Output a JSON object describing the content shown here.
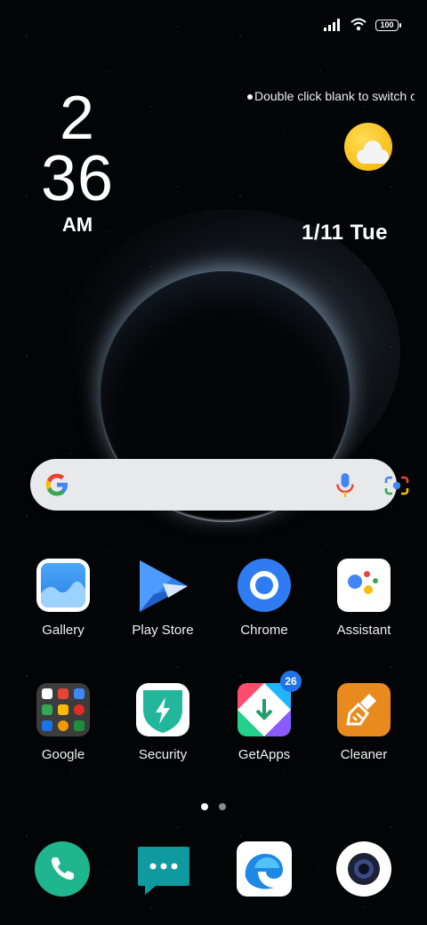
{
  "status_bar": {
    "battery": "100",
    "icons": [
      "signal-icon",
      "wifi-icon",
      "battery-icon"
    ]
  },
  "clock": {
    "hour": "2",
    "minute": "36",
    "ampm": "AM"
  },
  "hint": "Double click blank to switch cl",
  "date": "1/11  Tue",
  "weather": {
    "icon": "partly-sunny-icon"
  },
  "search": {
    "icons": [
      "google-logo-icon",
      "microphone-icon",
      "lens-camera-icon"
    ]
  },
  "apps_row1": [
    {
      "name": "Gallery"
    },
    {
      "name": "Play Store"
    },
    {
      "name": "Chrome"
    },
    {
      "name": "Assistant"
    }
  ],
  "apps_row2": [
    {
      "name": "Google"
    },
    {
      "name": "Security"
    },
    {
      "name": "GetApps",
      "badge": "26"
    },
    {
      "name": "Cleaner"
    }
  ],
  "pager": {
    "pages": 2,
    "active": 1
  },
  "dock": [
    "phone-icon",
    "messages-icon",
    "browser-icon",
    "camera-icon"
  ],
  "colors": {
    "accent": "#1e73e8",
    "phone": "#1fb58e",
    "messages": "#0e9aa0",
    "cleaner": "#e98a1f",
    "security": "#22b69a"
  }
}
